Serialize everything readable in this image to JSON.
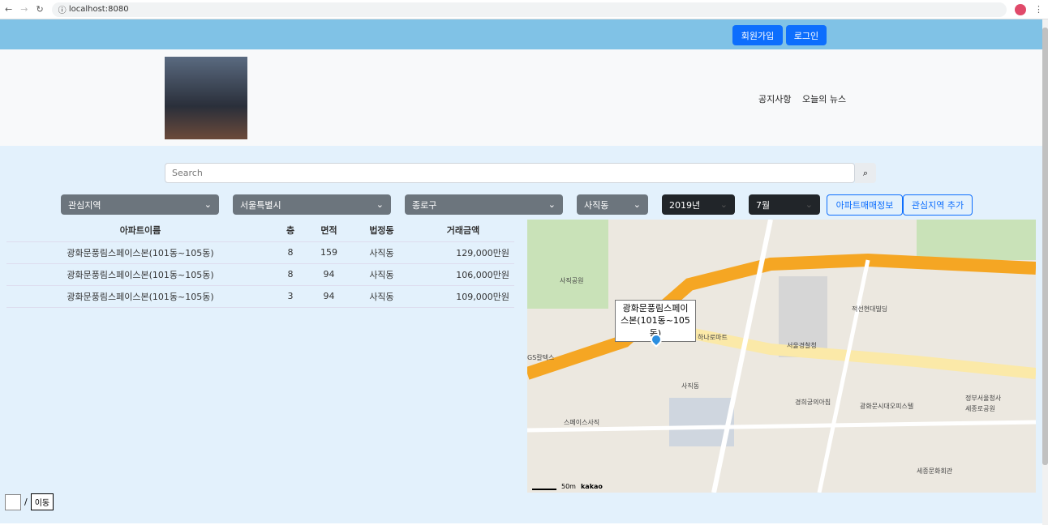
{
  "browser": {
    "url": "localhost:8080"
  },
  "topbar": {
    "signup": "회원가입",
    "login": "로그인"
  },
  "nav": {
    "notice": "공지사항",
    "news": "오늘의 뉴스"
  },
  "search": {
    "placeholder": "Search"
  },
  "filters": {
    "interest": "관심지역",
    "city": "서울특별시",
    "gu": "종로구",
    "dong": "사직동",
    "year": "2019년",
    "month": "7월",
    "apt_info": "아파트매매정보",
    "add_interest": "관심지역 추가"
  },
  "table": {
    "headers": [
      "아파트이름",
      "층",
      "면적",
      "법정동",
      "거래금액"
    ],
    "rows": [
      [
        "광화문풍림스페이스본(101동~105동)",
        "8",
        "159",
        "사직동",
        "129,000만원"
      ],
      [
        "광화문풍림스페이스본(101동~105동)",
        "8",
        "94",
        "사직동",
        "106,000만원"
      ],
      [
        "광화문풍림스페이스본(101동~105동)",
        "3",
        "94",
        "사직동",
        "109,000만원"
      ]
    ]
  },
  "map": {
    "marker_label": "광화문풍림스페이스본(101동~105동)",
    "scale": "50m",
    "brand": "kakao",
    "places": [
      "사직공원",
      "세종문화회관",
      "정부서울청사",
      "서울경찰청",
      "경희궁의아침",
      "스페이스사직",
      "사직동",
      "세종로공원",
      "광화문시대오피스텔",
      "하나로마트",
      "적선현대빌딩",
      "GS칼텍스"
    ],
    "road_color": "#f5a623"
  },
  "pager": {
    "separator": "/",
    "go": "이동"
  }
}
